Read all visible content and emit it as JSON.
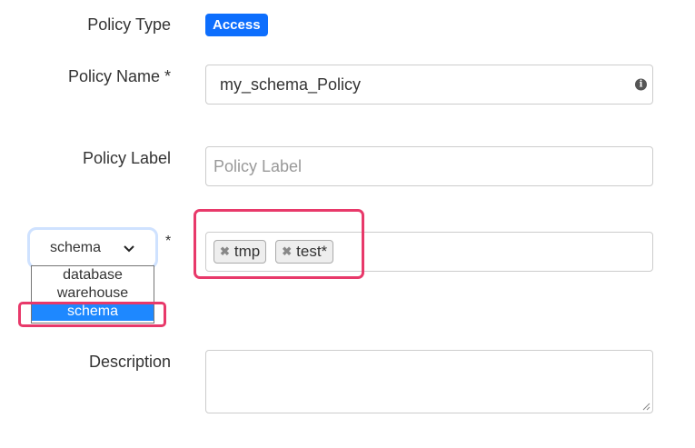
{
  "policy_type": {
    "label": "Policy Type",
    "badge": "Access"
  },
  "policy_name": {
    "label": "Policy Name *",
    "value": "my_schema_Policy",
    "info_icon": "info-icon"
  },
  "policy_label": {
    "label": "Policy Label",
    "placeholder": "Policy Label"
  },
  "resource": {
    "selected": "schema",
    "required_mark": "*",
    "options": [
      "database",
      "warehouse",
      "schema"
    ],
    "tags": [
      "tmp",
      "test*"
    ]
  },
  "description": {
    "label": "Description"
  },
  "colors": {
    "accent": "#0d6efd",
    "highlight": "#e8396a",
    "selected_option": "#1e88ff"
  }
}
